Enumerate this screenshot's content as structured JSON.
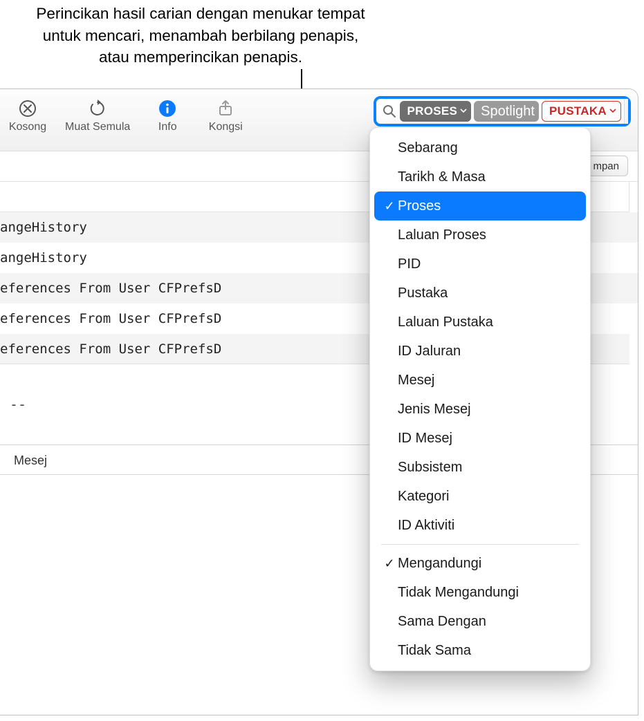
{
  "callout": "Perincikan hasil carian dengan menukar tempat untuk mencari, menambah berbilang penapis, atau memperincikan penapis.",
  "toolbar": {
    "clear": "Kosong",
    "reload": "Muat Semula",
    "info": "Info",
    "share": "Kongsi"
  },
  "search": {
    "token_process": "PROSES",
    "token_value": "Spotlight",
    "token_library": "PUSTAKA"
  },
  "subbar": {
    "save": "mpan"
  },
  "rows": [
    "angeHistory",
    "angeHistory",
    "eferences From User CFPrefsD",
    "eferences From User CFPrefsD",
    "eferences From User CFPrefsD"
  ],
  "details": "--",
  "column_header": "Mesej",
  "dropdown": {
    "group1": [
      {
        "label": "Sebarang",
        "checked": false
      },
      {
        "label": "Tarikh & Masa",
        "checked": false
      },
      {
        "label": "Proses",
        "checked": true,
        "selected": true
      },
      {
        "label": "Laluan Proses",
        "checked": false
      },
      {
        "label": "PID",
        "checked": false
      },
      {
        "label": "Pustaka",
        "checked": false
      },
      {
        "label": "Laluan Pustaka",
        "checked": false
      },
      {
        "label": "ID Jaluran",
        "checked": false
      },
      {
        "label": "Mesej",
        "checked": false
      },
      {
        "label": "Jenis Mesej",
        "checked": false
      },
      {
        "label": "ID Mesej",
        "checked": false
      },
      {
        "label": "Subsistem",
        "checked": false
      },
      {
        "label": "Kategori",
        "checked": false
      },
      {
        "label": "ID Aktiviti",
        "checked": false
      }
    ],
    "group2": [
      {
        "label": "Mengandungi",
        "checked": true
      },
      {
        "label": "Tidak Mengandungi",
        "checked": false
      },
      {
        "label": "Sama Dengan",
        "checked": false
      },
      {
        "label": "Tidak Sama",
        "checked": false
      }
    ]
  }
}
